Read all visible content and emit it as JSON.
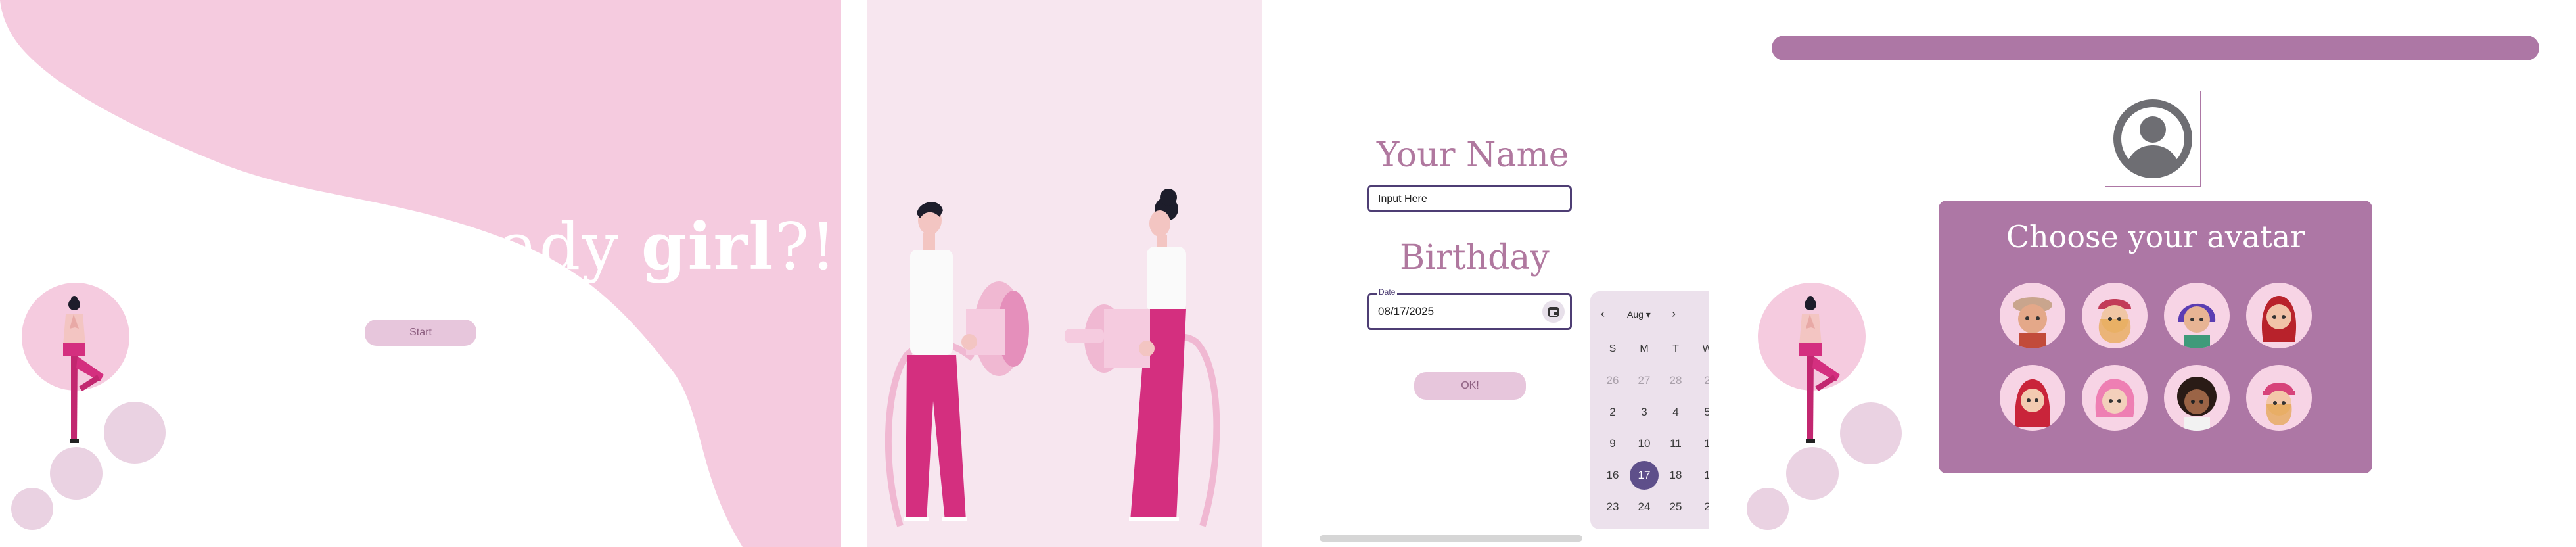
{
  "welcome": {
    "title_part1": "Are you ready ",
    "title_bold": "girl",
    "title_part2": "?!",
    "start_label": "Start"
  },
  "form": {
    "name_title": "Your Name",
    "name_value": "Input Here",
    "birthday_title": "Birthday",
    "date_label": "Date",
    "date_value": "08/17/2025",
    "ok_label": "OK!"
  },
  "calendar": {
    "month": "Aug",
    "weekdays": [
      "S",
      "M",
      "T",
      "W"
    ],
    "rows": [
      [
        "26",
        "27",
        "28",
        "2"
      ],
      [
        "2",
        "3",
        "4",
        "5"
      ],
      [
        "9",
        "10",
        "11",
        "1"
      ],
      [
        "16",
        "17",
        "18",
        "1"
      ],
      [
        "23",
        "24",
        "25",
        "2"
      ]
    ],
    "selected_day": "17"
  },
  "avatar": {
    "title": "Choose your avatar",
    "options": [
      "avatar-1",
      "avatar-2",
      "avatar-3",
      "avatar-4",
      "avatar-5",
      "avatar-6",
      "avatar-7",
      "avatar-8"
    ]
  },
  "colors": {
    "pink_light": "#f5cbdf",
    "pink_bg": "#f7e6ef",
    "accent": "#ad77a5",
    "button": "#e7c6dc",
    "dark_purple": "#4e3e74",
    "figure_pink": "#d42f7f"
  }
}
